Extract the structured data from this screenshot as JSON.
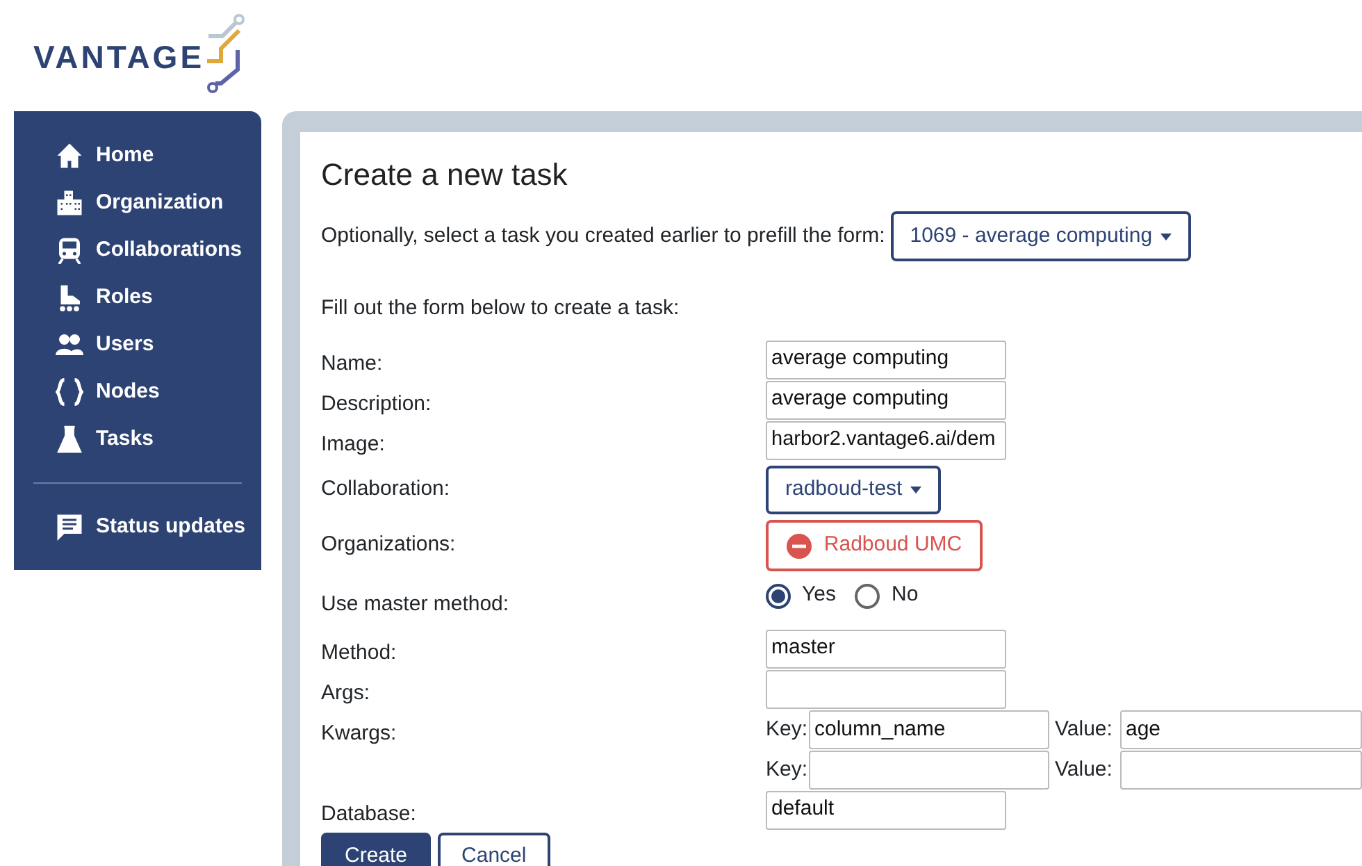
{
  "logo": {
    "text": "VANTAGE"
  },
  "sidebar": {
    "items": [
      {
        "label": "Home"
      },
      {
        "label": "Organization"
      },
      {
        "label": "Collaborations"
      },
      {
        "label": "Roles"
      },
      {
        "label": "Users"
      },
      {
        "label": "Nodes"
      },
      {
        "label": "Tasks"
      }
    ],
    "footer_items": [
      {
        "label": "Status updates"
      }
    ]
  },
  "form": {
    "title": "Create a new task",
    "prefill_label": "Optionally, select a task you created earlier to prefill the form:",
    "prefill_value": "1069 - average computing",
    "intro": "Fill out the form below to create a task:",
    "fields": [
      {
        "kind": "text",
        "label": "Name:",
        "value": "average computing"
      },
      {
        "kind": "text",
        "label": "Description:",
        "value": "average computing"
      },
      {
        "kind": "text",
        "label": "Image:",
        "value": "harbor2.vantage6.ai/dem"
      },
      {
        "kind": "dropdown",
        "label": "Collaboration:",
        "value": "radboud-test"
      },
      {
        "kind": "orgs",
        "label": "Organizations:",
        "items": [
          "Radboud UMC"
        ]
      },
      {
        "kind": "radio",
        "label": "Use master method:",
        "options": [
          {
            "label": "Yes",
            "selected": true
          },
          {
            "label": "No",
            "selected": false
          }
        ]
      },
      {
        "kind": "text",
        "label": "Method:",
        "value": "master"
      },
      {
        "kind": "text",
        "label": "Args:"
      },
      {
        "kind": "kwargs",
        "label": "Kwargs:",
        "pairs": [
          {
            "key_label": "Key:",
            "key": "column_name",
            "value_label": "Value:",
            "value": "age"
          },
          {
            "key_label": "Key:",
            "value_label": "Value:"
          }
        ]
      },
      {
        "kind": "text",
        "label": "Database:",
        "value": "default"
      }
    ],
    "buttons": [
      {
        "label": "Create",
        "primary": true
      },
      {
        "label": "Cancel",
        "primary": false
      }
    ]
  }
}
